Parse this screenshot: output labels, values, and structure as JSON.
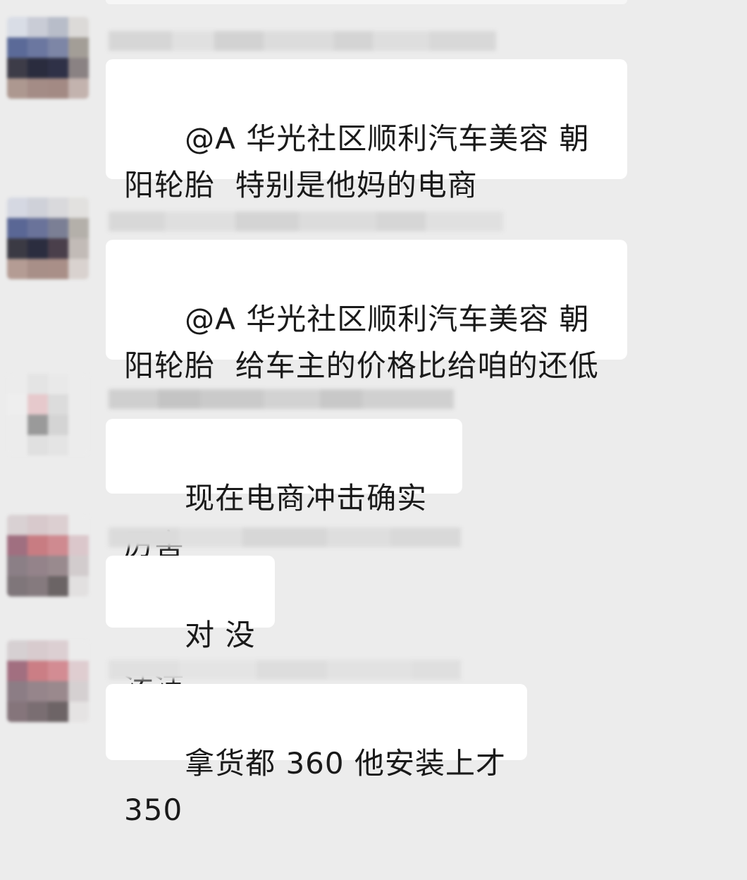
{
  "messages": [
    {
      "text": "@A 华光社区顺利汽车美容 朝阳轮胎  特别是他妈的电商"
    },
    {
      "text": "@A 华光社区顺利汽车美容 朝阳轮胎  给车主的价格比给咱的还低"
    },
    {
      "text": "现在电商冲击确实厉害"
    },
    {
      "text": "对 没法活"
    },
    {
      "text": "拿货都 360 他安装上才 350"
    }
  ]
}
